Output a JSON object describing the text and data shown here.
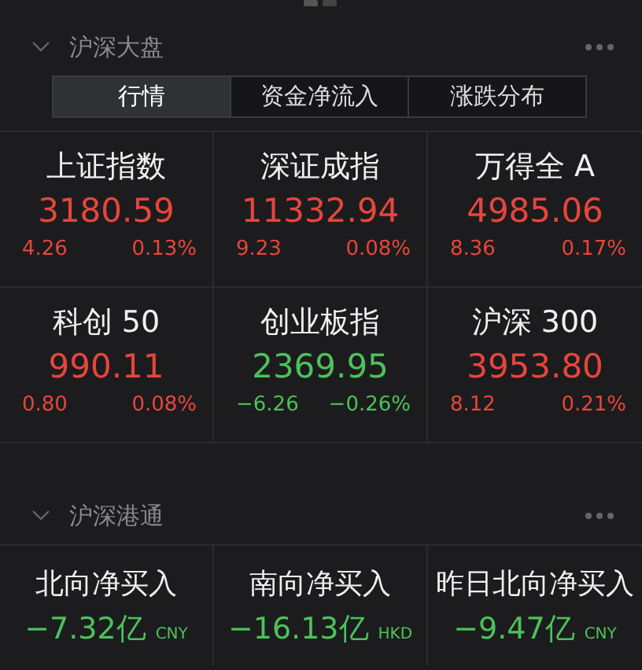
{
  "market": {
    "title": "沪深大盘",
    "expanded": true,
    "tabs": [
      {
        "label": "行情",
        "selected": true
      },
      {
        "label": "资金净流入",
        "selected": false
      },
      {
        "label": "涨跌分布",
        "selected": false
      }
    ],
    "indices": [
      {
        "name": "上证指数",
        "value": "3180.59",
        "change": "4.26",
        "percent": "0.13%",
        "color": "#e8453c"
      },
      {
        "name": "深证成指",
        "value": "11332.94",
        "change": "9.23",
        "percent": "0.08%",
        "color": "#e8453c"
      },
      {
        "name": "万得全 A",
        "value": "4985.06",
        "change": "8.36",
        "percent": "0.17%",
        "color": "#e8453c"
      },
      {
        "name": "科创 50",
        "value": "990.11",
        "change": "0.80",
        "percent": "0.08%",
        "color": "#e8453c"
      },
      {
        "name": "创业板指",
        "value": "2369.95",
        "change": "−6.26",
        "percent": "−0.26%",
        "color": "#4bc25a"
      },
      {
        "name": "沪深 300",
        "value": "3953.80",
        "change": "8.12",
        "percent": "0.21%",
        "color": "#e8453c"
      }
    ]
  },
  "connect": {
    "title": "沪深港通",
    "expanded": true,
    "flows": [
      {
        "name": "北向净买入",
        "value": "−7.32亿",
        "currency": "CNY",
        "color": "#4bc25a"
      },
      {
        "name": "南向净买入",
        "value": "−16.13亿",
        "currency": "HKD",
        "color": "#4bc25a"
      },
      {
        "name": "昨日北向净买入",
        "value": "−9.47亿",
        "currency": "CNY",
        "color": "#4bc25a"
      }
    ]
  }
}
